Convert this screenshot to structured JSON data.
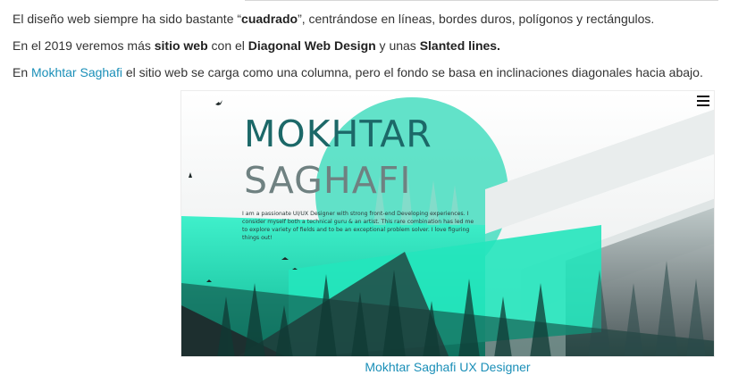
{
  "article": {
    "p1": {
      "t1": "El diseño web siempre ha sido bastante “",
      "b1": "cuadrado",
      "t2": "”, centrándose en líneas, bordes duros, polígonos y rectángulos."
    },
    "p2": {
      "t1": "En el 2019 veremos más ",
      "b1": "sitio web",
      "t2": " con el ",
      "b2": "Diagonal Web Design",
      "t3": " y unas ",
      "b3": "Slanted lines."
    },
    "p3": {
      "t1": "En ",
      "link": "Mokhtar Saghafi",
      "t2": " el sitio web se carga como una columna, pero el fondo se basa en inclinaciones diagonales hacia abajo."
    }
  },
  "screenshot": {
    "title_line1": "MOKHTAR",
    "title_line2": "SAGHAFI",
    "bio": "I am a passionate UI/UX Designer with strong front-end Developing experiences. I consider myself both a technical guru & an artist. This rare combination has led me to explore variety of fields and to be an exceptional problem solver. I love figuring things out!",
    "menu_icon": "hamburger-menu-icon"
  },
  "caption": "Mokhtar Saghafi UX Designer",
  "colors": {
    "text": "#333333",
    "link": "#1a8fb8",
    "accent_teal": "#1fe7bf",
    "title_teal": "#1c6868",
    "title_gray": "#6f8181"
  }
}
